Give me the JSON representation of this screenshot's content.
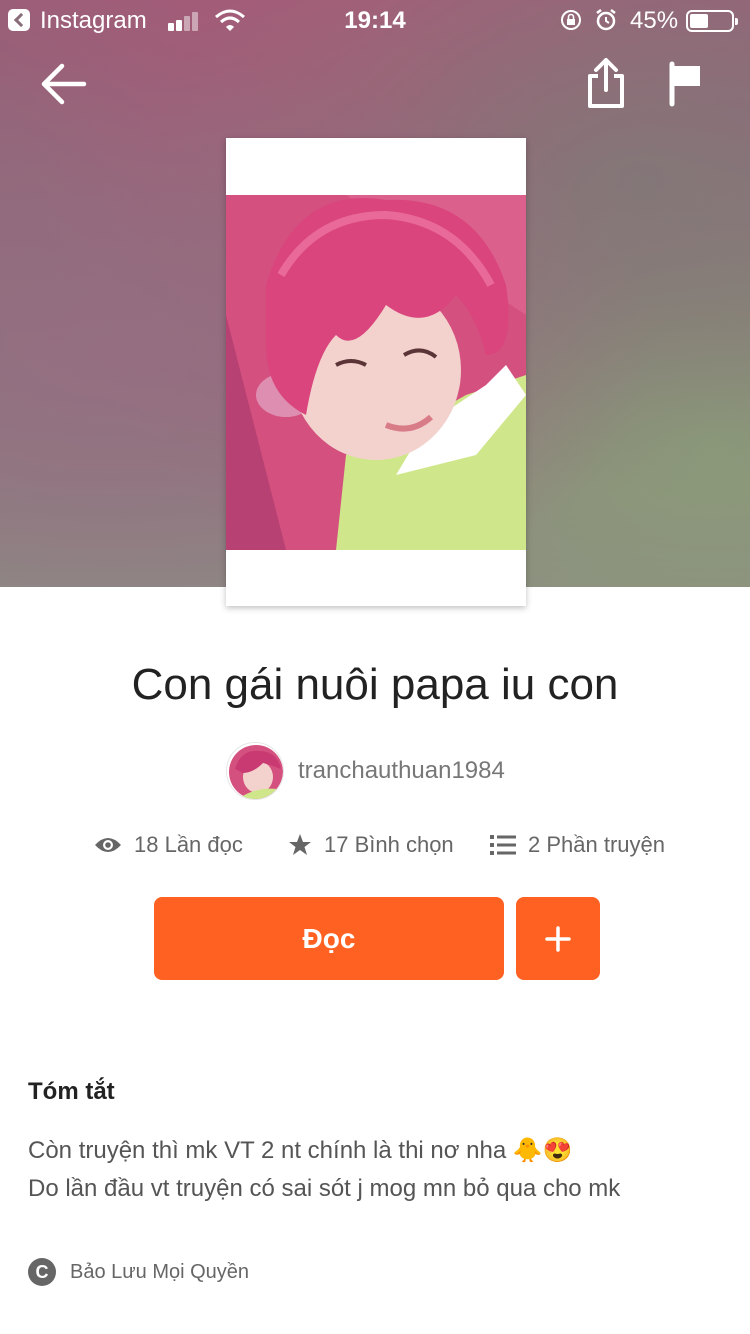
{
  "status_bar": {
    "back_app": "Instagram",
    "time": "19:14",
    "battery_percent": "45%",
    "battery_level": 0.45,
    "signal_bars": 2
  },
  "nav": {
    "back_icon": "arrow-left-icon",
    "share_icon": "share-icon",
    "report_icon": "flag-icon"
  },
  "story": {
    "title": "Con gái nuôi papa iu con",
    "author": "tranchauthuan1984",
    "stats": {
      "reads": "18 Lần đọc",
      "votes": "17 Bình chọn",
      "parts": "2 Phần truyện"
    }
  },
  "actions": {
    "read_label": "Đọc",
    "add_label": "+"
  },
  "summary": {
    "heading": "Tóm tắt",
    "line1": "Còn truyện thì mk VT 2 nt chính là thi nơ nha 🐥😍",
    "line2": "Do lần đầu vt truyện có sai sót j mog mn bỏ qua cho mk"
  },
  "license": {
    "icon": "C",
    "text": "Bảo Lưu Mọi Quyền"
  },
  "colors": {
    "accent": "#ff6122",
    "title_text": "#222222",
    "muted_text": "#777777"
  }
}
